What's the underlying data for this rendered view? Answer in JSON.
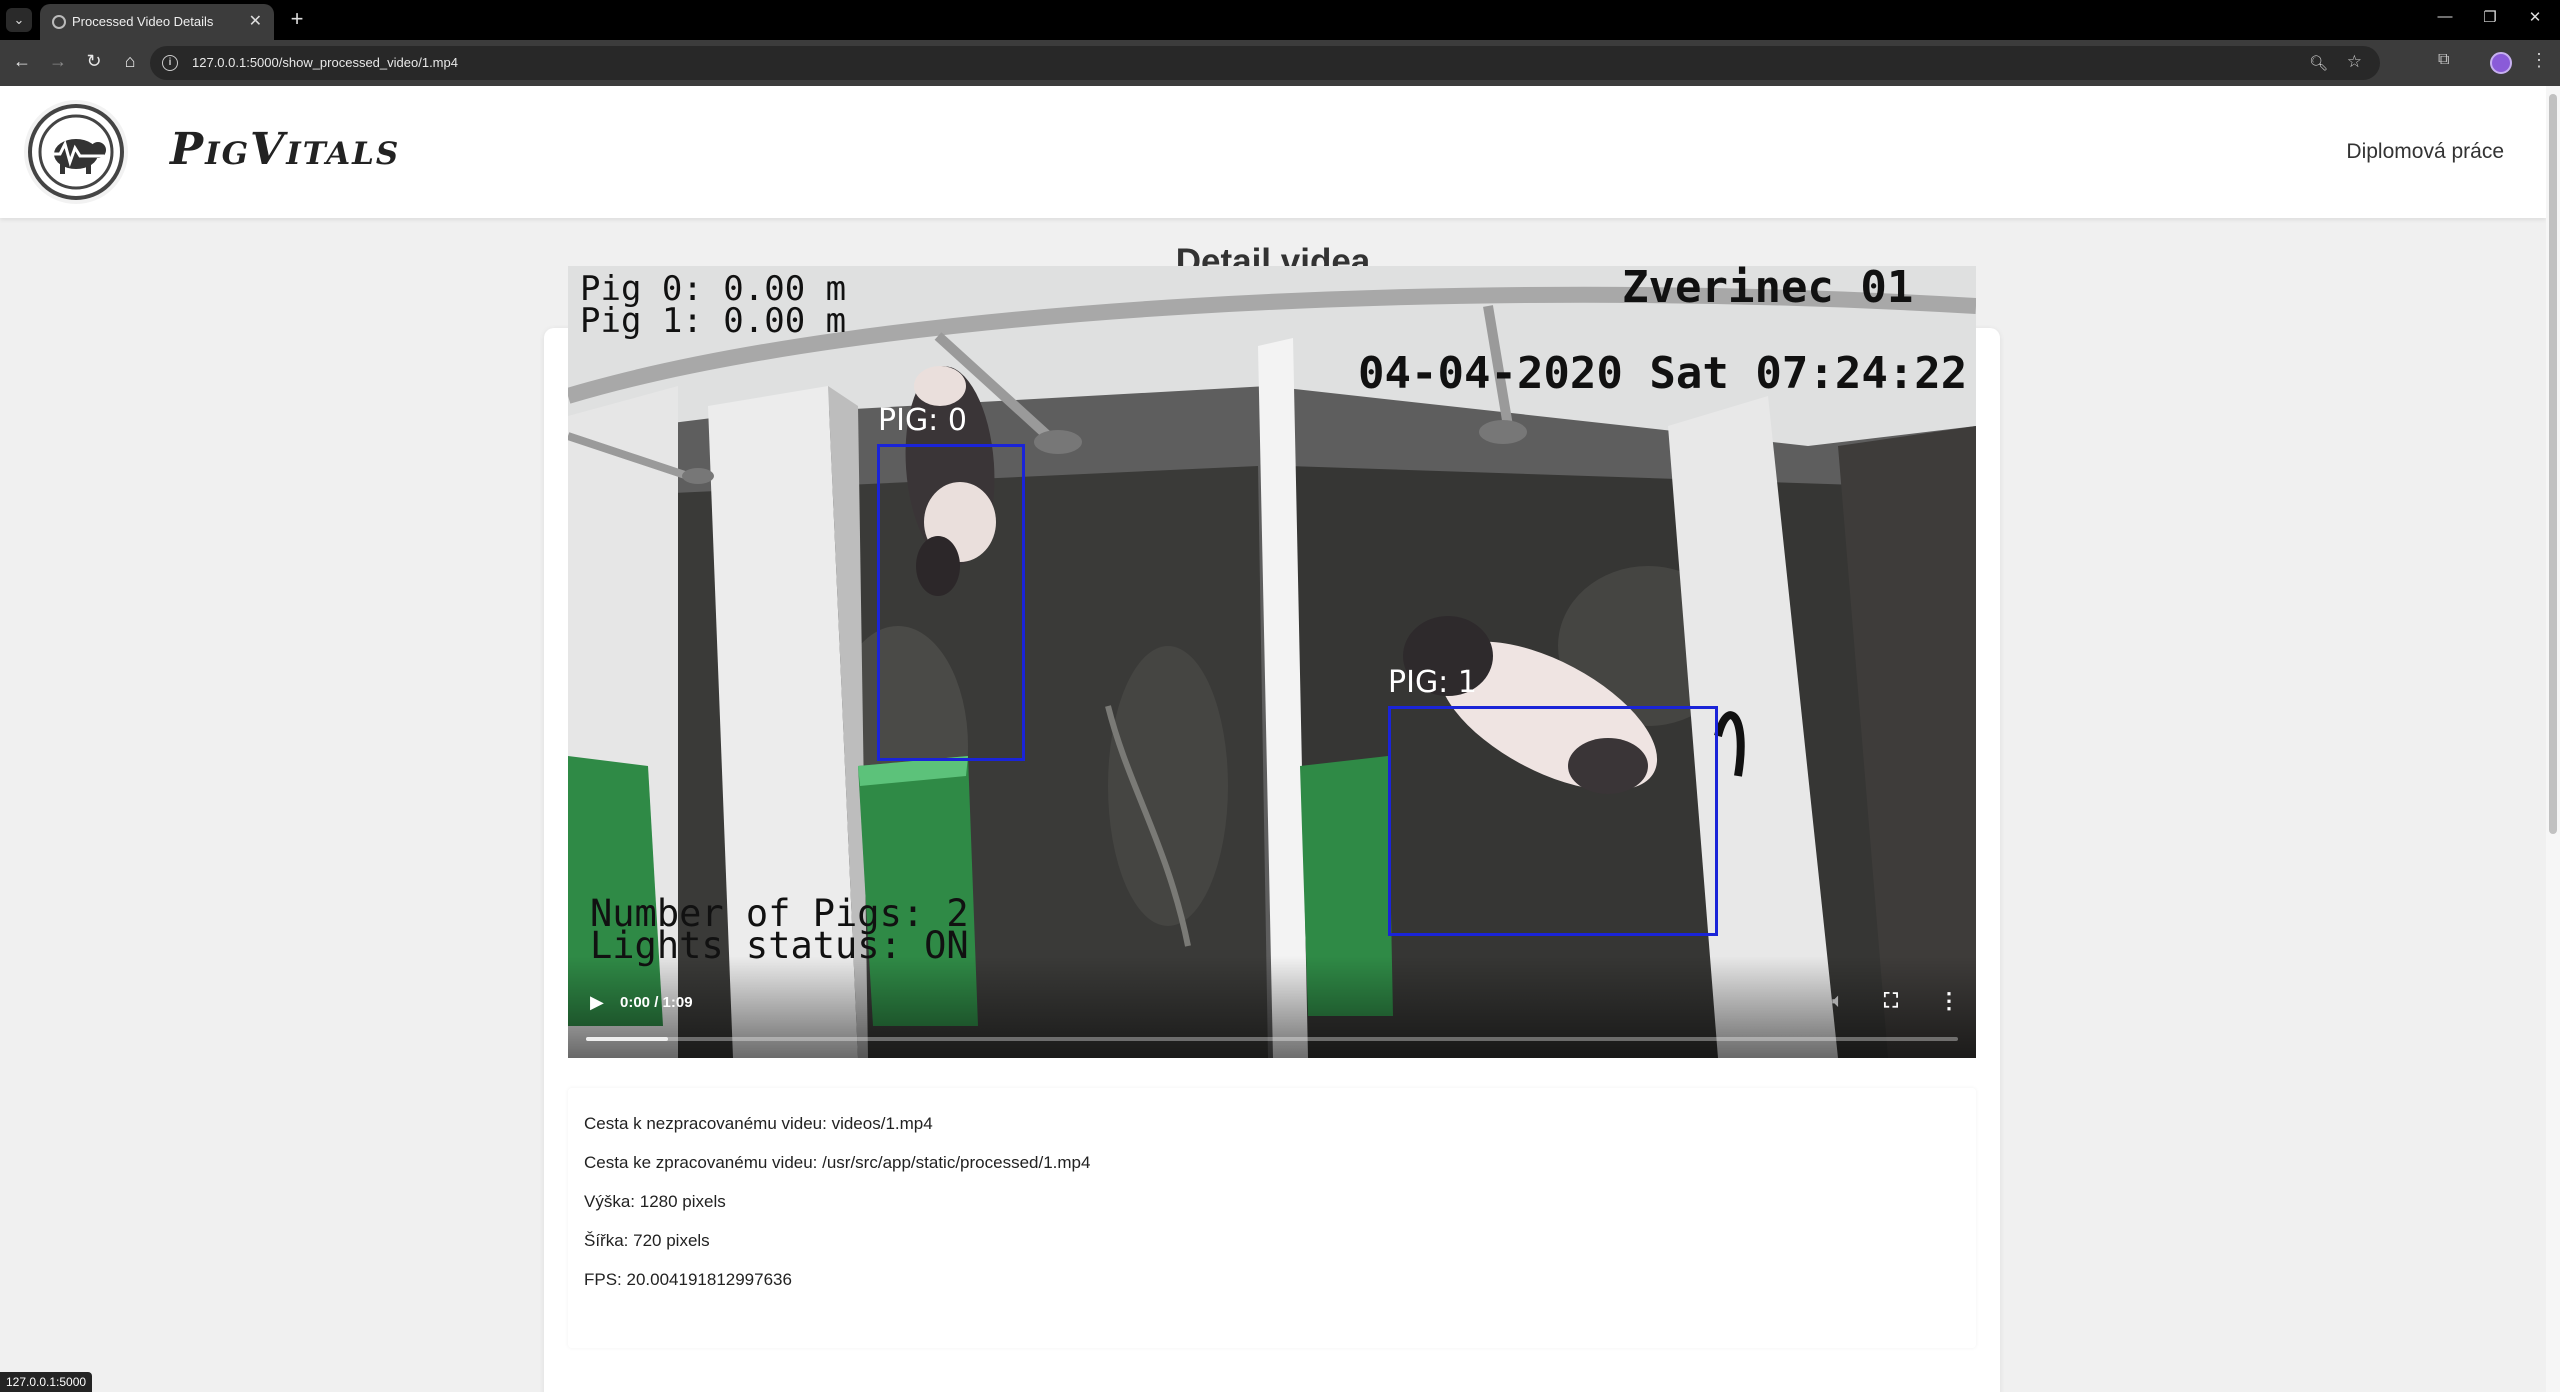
{
  "browser": {
    "tab_title": "Processed Video Details",
    "url": "127.0.0.1:5000/show_processed_video/1.mp4",
    "status_url": "127.0.0.1:5000"
  },
  "site": {
    "brand": "PigVitals",
    "nav_link": "Diplomová práce"
  },
  "page": {
    "title": "Detail videa"
  },
  "video": {
    "overlay": {
      "pig0_distance": "Pig 0: 0.00 m",
      "pig1_distance": "Pig 1: 0.00 m",
      "camera_name": "Zverinec 01",
      "timestamp": "04-04-2020 Sat 07:24:22",
      "pig_count": "Number of Pigs: 2",
      "lights_status": "Lights status: ON"
    },
    "detections": [
      {
        "label": "PIG: 0"
      },
      {
        "label": "PIG: 1"
      }
    ],
    "player": {
      "time": "0:00 / 1:09",
      "buffered_fraction": 0.06
    }
  },
  "details": {
    "raw_path": "Cesta k nezpracovanému videu: videos/1.mp4",
    "processed_path": "Cesta ke zpracovanému videu: /usr/src/app/static/processed/1.mp4",
    "height": "Výška: 1280 pixels",
    "width": "Šířka: 720 pixels",
    "fps": "FPS: 20.004191812997636"
  },
  "colors": {
    "bbox": "#1a24d8",
    "page_bg": "#f0f0f0"
  }
}
